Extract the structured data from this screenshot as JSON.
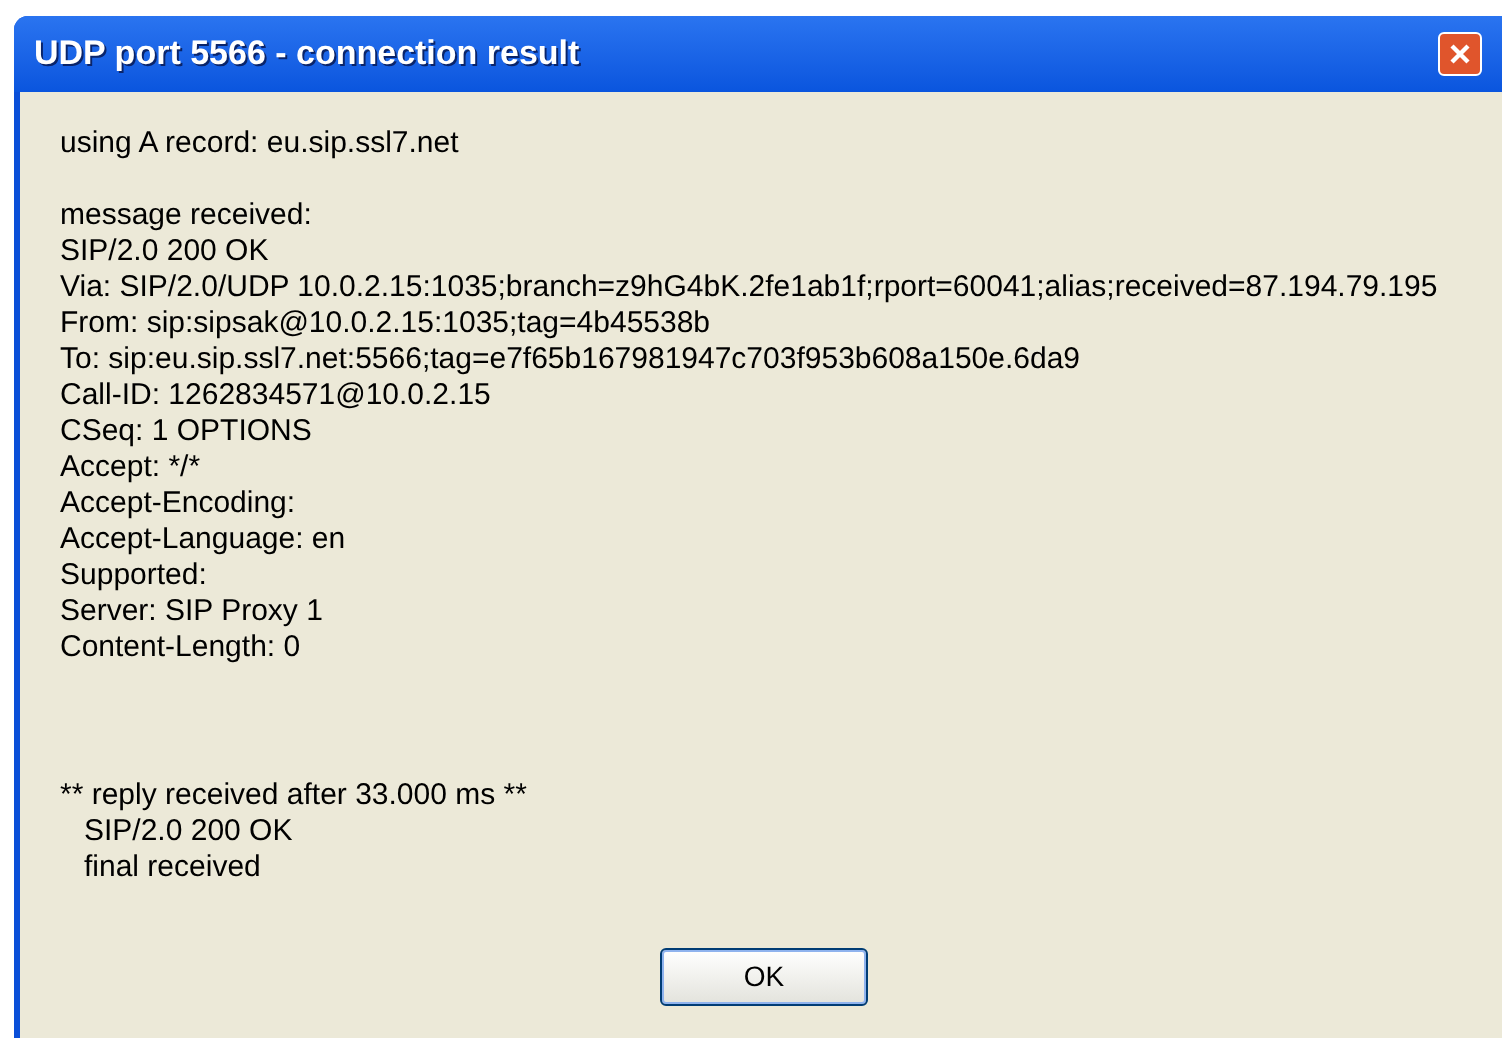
{
  "window": {
    "title": "UDP port 5566 - connection result"
  },
  "blocks": [
    {
      "kind": "plain",
      "lines": [
        {
          "text": "using A record: eu.sip.ssl7.net",
          "indented": false
        }
      ]
    },
    {
      "kind": "plain",
      "lines": [
        {
          "text": "message received:",
          "indented": false
        },
        {
          "text": "SIP/2.0 200 OK",
          "indented": false
        },
        {
          "text": "Via: SIP/2.0/UDP 10.0.2.15:1035;branch=z9hG4bK.2fe1ab1f;rport=60041;alias;received=87.194.79.195",
          "indented": false
        },
        {
          "text": "From: sip:sipsak@10.0.2.15:1035;tag=4b45538b",
          "indented": false
        },
        {
          "text": "To: sip:eu.sip.ssl7.net:5566;tag=e7f65b167981947c703f953b608a150e.6da9",
          "indented": false
        },
        {
          "text": "Call-ID: 1262834571@10.0.2.15",
          "indented": false
        },
        {
          "text": "CSeq: 1 OPTIONS",
          "indented": false
        },
        {
          "text": "Accept: */*",
          "indented": false
        },
        {
          "text": "Accept-Encoding:",
          "indented": false
        },
        {
          "text": "Accept-Language: en",
          "indented": false
        },
        {
          "text": "Supported:",
          "indented": false
        },
        {
          "text": "Server: SIP Proxy 1",
          "indented": false
        },
        {
          "text": "Content-Length: 0",
          "indented": false
        }
      ]
    },
    {
      "kind": "spaced",
      "lines": [
        {
          "text": "** reply received after 33.000 ms **",
          "indented": false
        },
        {
          "text": "SIP/2.0 200 OK",
          "indented": true
        },
        {
          "text": "final received",
          "indented": true
        }
      ]
    }
  ],
  "buttons": [
    {
      "label": "OK"
    }
  ]
}
